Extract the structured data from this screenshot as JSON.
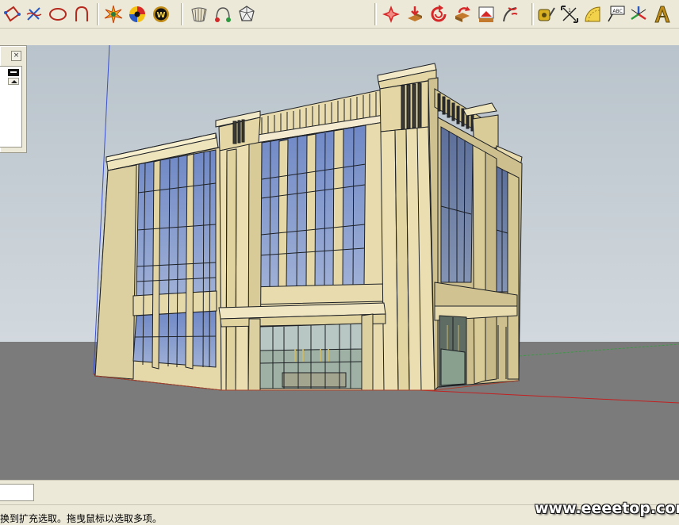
{
  "app": {
    "colors": {
      "sky": "#c7cfd5",
      "ground": "#797979",
      "facade": "#e8dcaf",
      "glass": "#7f97c8",
      "mullion": "#1d2024"
    }
  },
  "toolbar": {
    "groups": [
      {
        "tools": [
          "rotated-rectangle-tool",
          "freehand-tool",
          "ellipse-tool",
          "arc-tool"
        ]
      },
      {
        "tools": [
          "explosion-plugin-tool",
          "color-wheel-tool",
          "w-plugin-tool"
        ]
      },
      {
        "tools": [
          "shell-tool",
          "rope-tool",
          "polyhedron-tool"
        ]
      },
      {
        "tools": [
          "fold-tool",
          "drape-tool",
          "rotate-tool",
          "extrude-tool",
          "stamp-tool",
          "curve-tool"
        ]
      },
      {
        "tools": [
          "tape-measure-tool",
          "dimension-tool",
          "protractor-tool",
          "text-label-tool",
          "axes-tool",
          "3d-text-tool"
        ]
      }
    ]
  },
  "tray": {
    "close_glyph": "×"
  },
  "statusbar": {
    "hint": "换到扩充选取。拖曳鼠标以选取多项。"
  },
  "watermark": {
    "text": "www.eeeetop.com"
  }
}
